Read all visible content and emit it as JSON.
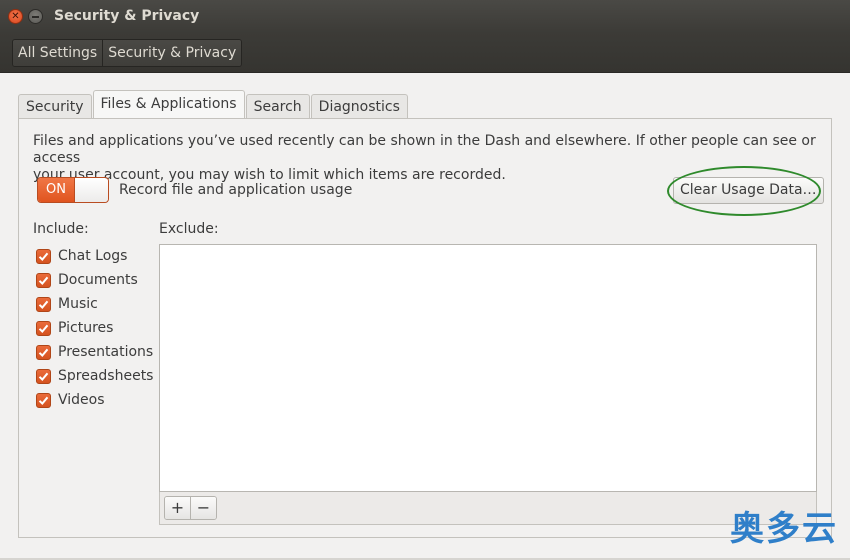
{
  "window": {
    "title": "Security & Privacy"
  },
  "breadcrumb": {
    "items": [
      {
        "label": "All Settings"
      },
      {
        "label": "Security & Privacy"
      }
    ]
  },
  "tabs": [
    {
      "label": "Security",
      "active": false
    },
    {
      "label": "Files & Applications",
      "active": true
    },
    {
      "label": "Search",
      "active": false
    },
    {
      "label": "Diagnostics",
      "active": false
    }
  ],
  "files_apps": {
    "description_line1": "Files and applications you’ve used recently can be shown in the Dash and elsewhere. If other people can see or access",
    "description_line2": "your user account, you may wish to limit which items are recorded.",
    "toggle": {
      "state_label": "ON",
      "on": true
    },
    "record_label": "Record file and application usage",
    "clear_button_label": "Clear Usage Data…",
    "include_label": "Include:",
    "exclude_label": "Exclude:",
    "include_items": [
      {
        "label": "Chat Logs",
        "checked": true
      },
      {
        "label": "Documents",
        "checked": true
      },
      {
        "label": "Music",
        "checked": true
      },
      {
        "label": "Pictures",
        "checked": true
      },
      {
        "label": "Presentations",
        "checked": true
      },
      {
        "label": "Spreadsheets",
        "checked": true
      },
      {
        "label": "Videos",
        "checked": true
      }
    ],
    "add_label": "+",
    "remove_label": "−"
  },
  "colors": {
    "accent": "#e0541f",
    "highlight_ring": "#2f8a2c",
    "titlebar": "#3c3b37"
  },
  "watermark": {
    "text": "奥多云"
  }
}
